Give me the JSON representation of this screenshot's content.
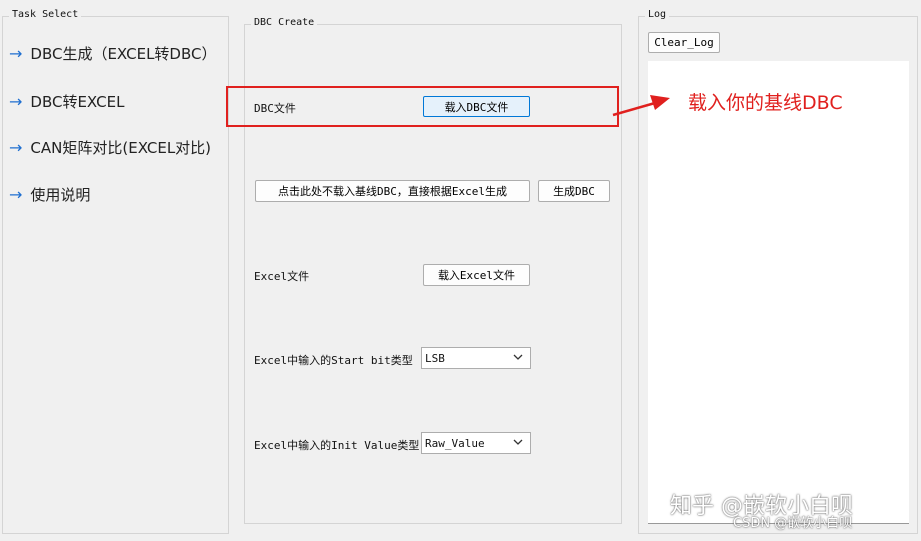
{
  "task_select": {
    "title": "Task Select",
    "items": [
      {
        "label": "DBC生成（EXCEL转DBC）"
      },
      {
        "label": "DBC转EXCEL"
      },
      {
        "label": "CAN矩阵对比(EXCEL对比)"
      },
      {
        "label": "使用说明"
      }
    ]
  },
  "dbc_create": {
    "title": "DBC Create",
    "dbc_file_label": "DBC文件",
    "load_dbc_button": "载入DBC文件",
    "direct_generate_button": "点击此处不载入基线DBC，直接根据Excel生成",
    "generate_dbc_button": "生成DBC",
    "excel_file_label": "Excel文件",
    "load_excel_button": "载入Excel文件",
    "start_bit_label": "Excel中输入的Start bit类型",
    "start_bit_value": "LSB",
    "init_value_label": "Excel中输入的Init Value类型",
    "init_value_value": "Raw_Value"
  },
  "log": {
    "title": "Log",
    "clear_button": "Clear_Log"
  },
  "annotation": {
    "text": "载入你的基线DBC",
    "color": "#e0201e"
  },
  "watermark": {
    "main": "知乎 @嵌软小白呗",
    "sub": "CSDN @嵌软小白呗"
  }
}
